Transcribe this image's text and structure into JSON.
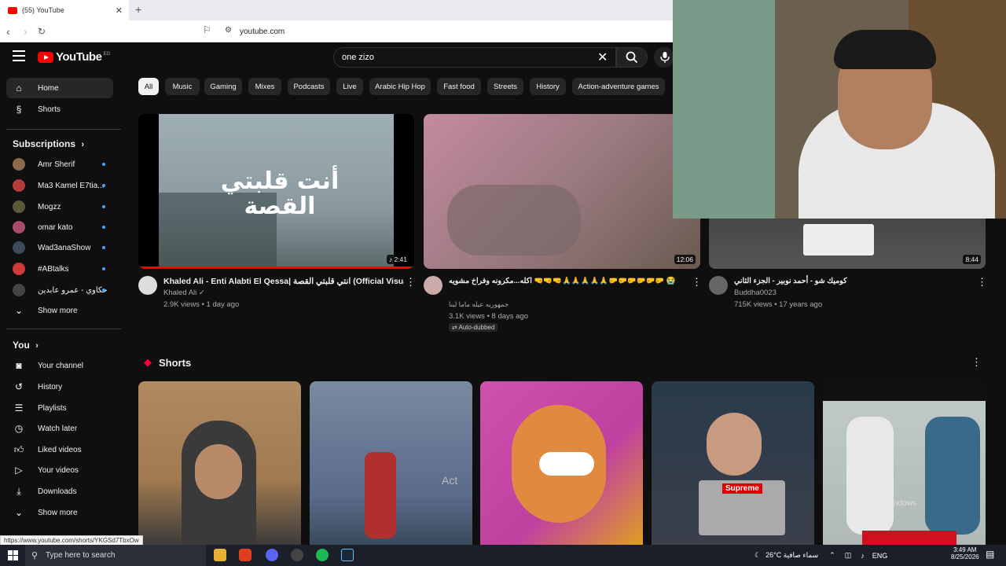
{
  "browser": {
    "tab_title": "(55) YouTube",
    "new_tab": "+",
    "url": "youtube.com"
  },
  "header": {
    "logo_text": "YouTube",
    "region": "EG",
    "search_value": "one zizo"
  },
  "sidebar": {
    "main": [
      {
        "label": "Home",
        "icon": "home-icon"
      },
      {
        "label": "Shorts",
        "icon": "shorts-icon"
      }
    ],
    "subscriptions_title": "Subscriptions",
    "subscriptions": [
      {
        "label": "Amr Sherif",
        "color": "#8a6a4a"
      },
      {
        "label": "Ma3 Kamel E7tia...",
        "color": "#b33b3b"
      },
      {
        "label": "Mogzz",
        "color": "#5a5a3a"
      },
      {
        "label": "omar kato",
        "color": "#a84a6a"
      },
      {
        "label": "Wad3anaShow",
        "color": "#3a4a5a"
      },
      {
        "label": "#ABtalks",
        "color": "#d23a3a"
      },
      {
        "label": "حكاوي - عمرو عابدين",
        "color": "#444444"
      }
    ],
    "subs_show_more": "Show more",
    "you_title": "You",
    "you": [
      {
        "label": "Your channel",
        "icon": "account-icon"
      },
      {
        "label": "History",
        "icon": "history-icon"
      },
      {
        "label": "Playlists",
        "icon": "playlists-icon"
      },
      {
        "label": "Watch later",
        "icon": "clock-icon"
      },
      {
        "label": "Liked videos",
        "icon": "thumbs-up-icon"
      },
      {
        "label": "Your videos",
        "icon": "video-icon"
      },
      {
        "label": "Downloads",
        "icon": "download-icon"
      }
    ],
    "you_show_more": "Show more"
  },
  "chips": [
    "All",
    "Music",
    "Gaming",
    "Mixes",
    "Podcasts",
    "Live",
    "Arabic Hip Hop",
    "Fast food",
    "Streets",
    "History",
    "Action-adventure games"
  ],
  "videos": [
    {
      "title": "Khaled Ali - Enti Alabti El Qessa| انتي قلبتي القصة (Official Visualizer)",
      "channel": "Khaled Ali",
      "meta": "2.9K views • 1 day ago",
      "duration": "2:41",
      "thumb_text": "أنت قلبتي القصة",
      "thumb_color": "#8a9aa0"
    },
    {
      "title": "اكله...مكرونه وفراخ مشويه 🤜🤜🤜🙏🙏🙏🙏🙏🤛🤛🤛🤛🤛🤛 😭",
      "channel": "جمهوريه عيله ماما لبنا",
      "meta": "3.1K views • 8 days ago",
      "badge": "Auto-dubbed",
      "duration": "12:06",
      "thumb_color": "#9a7a80"
    },
    {
      "title": "كوميك شو - أحمد نوبير - الجزء الثاني",
      "channel": "Buddha0023",
      "meta": "715K views • 17 years ago",
      "duration": "8:44",
      "thumb_color": "#4a4a4a"
    }
  ],
  "shorts_title": "Shorts",
  "shorts": [
    {
      "color": "#a07a50"
    },
    {
      "color": "#5a6a8a",
      "text": "Act"
    },
    {
      "color": "#c040a0"
    },
    {
      "color": "#3a3f4a",
      "text": "Supreme"
    },
    {
      "color": "#c0c8c8",
      "text": "Activate Windows"
    }
  ],
  "status_url": "https://www.youtube.com/shorts/YKGSd7TbxOw",
  "taskbar": {
    "search_placeholder": "Type here to search",
    "weather": "26°C سماء صافية",
    "lang": "ENG",
    "time": "3:49 AM",
    "date": "8/25/2026"
  }
}
